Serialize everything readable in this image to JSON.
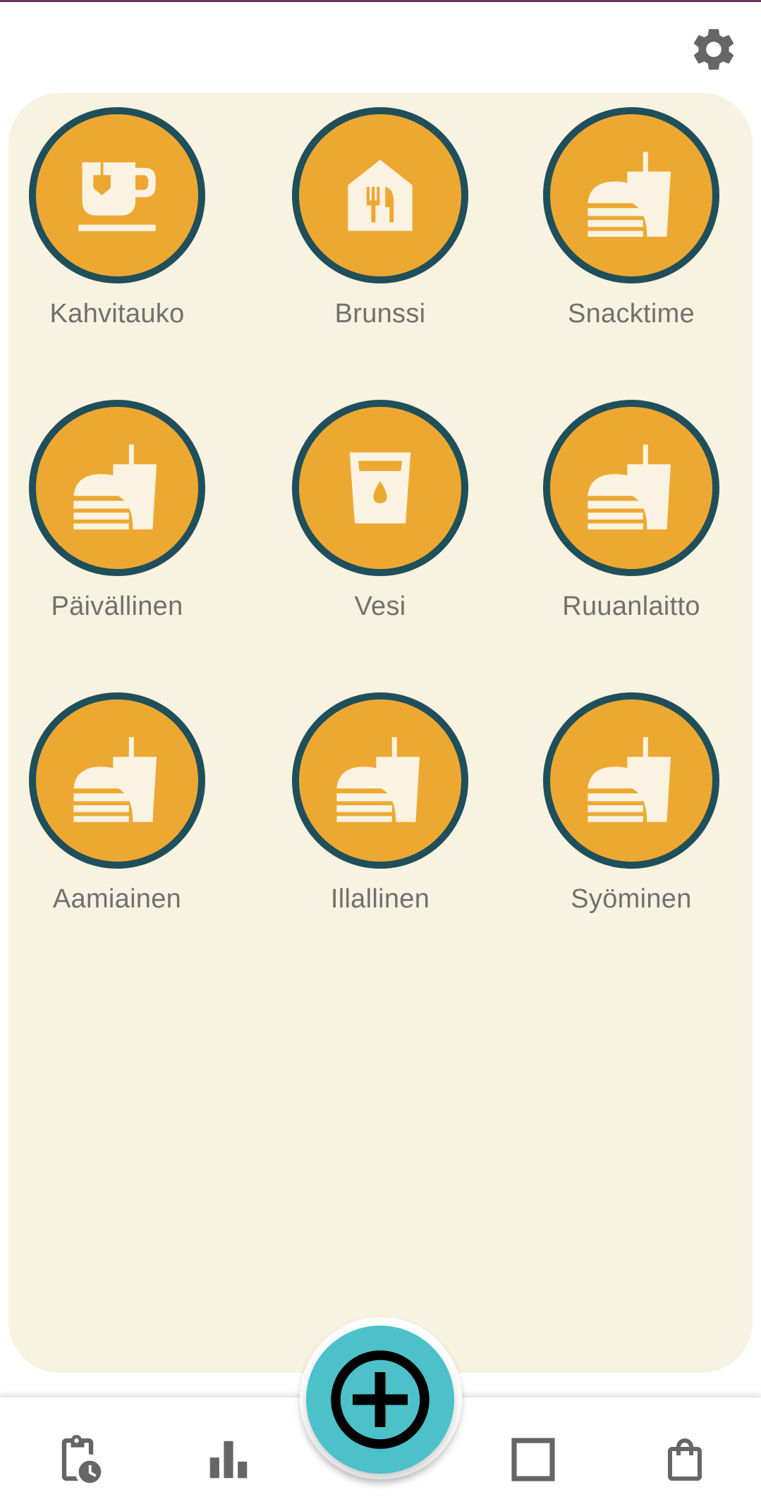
{
  "header": {
    "settings_icon": "gear-icon"
  },
  "activities": [
    {
      "label": "Kahvitauko",
      "icon": "coffee-cup-icon"
    },
    {
      "label": "Brunssi",
      "icon": "restaurant-house-icon"
    },
    {
      "label": "Snacktime",
      "icon": "fast-food-icon"
    },
    {
      "label": "Päivällinen",
      "icon": "fast-food-icon"
    },
    {
      "label": "Vesi",
      "icon": "water-glass-icon"
    },
    {
      "label": "Ruuanlaitto",
      "icon": "fast-food-icon"
    },
    {
      "label": "Aamiainen",
      "icon": "fast-food-icon"
    },
    {
      "label": "Illallinen",
      "icon": "fast-food-icon"
    },
    {
      "label": "Syöminen",
      "icon": "fast-food-icon"
    }
  ],
  "bottom_nav": [
    {
      "icon": "clipboard-clock-icon"
    },
    {
      "icon": "bar-chart-icon"
    },
    {
      "icon": "add-circle-icon"
    },
    {
      "icon": "square-icon"
    },
    {
      "icon": "shopping-bag-icon"
    }
  ],
  "colors": {
    "panel_background": "#f8f2e0",
    "circle_fill": "#eda832",
    "circle_border": "#1f4f5a",
    "icon_fill": "#fbf3e1",
    "label_text": "#707070",
    "fab": "#4dc1c9",
    "nav_icon": "#666666"
  }
}
